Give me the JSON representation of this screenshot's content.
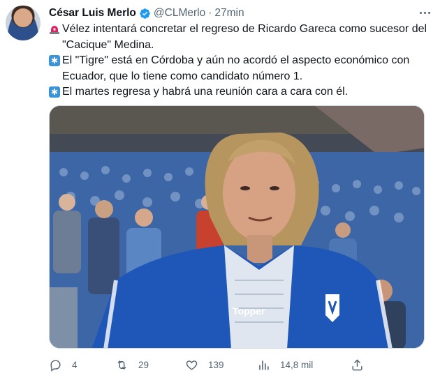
{
  "author": {
    "name": "César Luis Merlo",
    "handle": "@CLMerlo",
    "separator": "·",
    "time": "27min",
    "verified": true
  },
  "tweet": {
    "lines": [
      {
        "emoji": "siren-icon",
        "text": "Vélez intentará concretar el regreso de Ricardo Gareca como sucesor del \"Cacique\" Medina."
      },
      {
        "emoji": "asterisk-icon",
        "text": "El \"Tigre\" está en Córdoba y aún no acordó el aspecto económico con Ecuador, que lo tiene como candidato número 1."
      },
      {
        "emoji": "asterisk-icon",
        "text": "El martes regresa y habrá una reunión cara a cara con él."
      }
    ]
  },
  "media": {
    "jersey_brand": "Topper"
  },
  "actions": {
    "replies": "4",
    "retweets": "29",
    "likes": "139",
    "views": "14,8 mil"
  },
  "colors": {
    "verified": "#1d9bf0",
    "muted": "#536471",
    "text": "#0f1419"
  }
}
